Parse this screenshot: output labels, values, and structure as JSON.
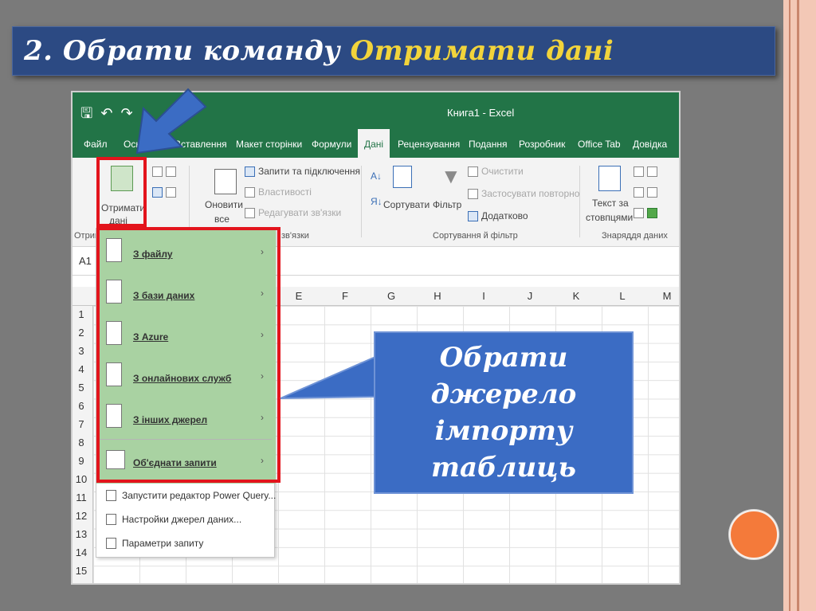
{
  "slide": {
    "title_prefix": "2.  Обрати команду ",
    "title_highlight": "Отримати дані",
    "callout_lines": [
      "Обрати",
      "джерело",
      "імпорту",
      "таблиць"
    ]
  },
  "excel": {
    "window_title": "Книга1  -  Excel",
    "tabs": [
      "Файл",
      "Осно",
      "Вставлення",
      "Макет сторінки",
      "Формули",
      "Дані",
      "Рецензування",
      "Подання",
      "Розробник",
      "Office Tab",
      "Довідка"
    ],
    "active_tab": "Дані",
    "ribbon": {
      "get_data_label_1": "Отримати",
      "get_data_label_2": "дані",
      "group_get_label": "Отрим",
      "refresh_label_1": "Оновити",
      "refresh_label_2": "все",
      "queries_connections": "Запити та підключення",
      "properties": "Властивості",
      "edit_links": "Редагувати зв'язки",
      "group_queries_label": "зв'язки",
      "sort_label": "Сортувати",
      "filter_label": "Фільтр",
      "clear_label": "Очистити",
      "reapply_label": "Застосувати повторно",
      "advanced_label": "Додатково",
      "group_sort_label": "Сортування й фільтр",
      "text_to_columns_1": "Текст за",
      "text_to_columns_2": "стовпцями",
      "group_tools_label": "Знаряддя даних"
    },
    "name_box": "A1",
    "columns": [
      "E",
      "F",
      "G",
      "H",
      "I",
      "J",
      "K",
      "L",
      "M"
    ],
    "rows": [
      "1",
      "2",
      "3",
      "4",
      "5",
      "6",
      "7",
      "8",
      "9",
      "10",
      "11",
      "12",
      "13",
      "14",
      "15"
    ],
    "menu": {
      "items": [
        "З файлу",
        "З бази даних",
        "З Azure",
        "З онлайнових служб",
        "З інших джерел",
        "Об'єднати запити"
      ],
      "extra_items": [
        "Запустити редактор Power Query...",
        "Настройки джерел даних...",
        "Параметри запиту"
      ]
    }
  },
  "colors": {
    "excel_green": "#227447",
    "highlight_red": "#e3141c",
    "callout_blue": "#3b6cc4",
    "banner_blue": "#2c4a83",
    "title_yellow": "#f2d43b",
    "accent_orange": "#f47a3a"
  }
}
